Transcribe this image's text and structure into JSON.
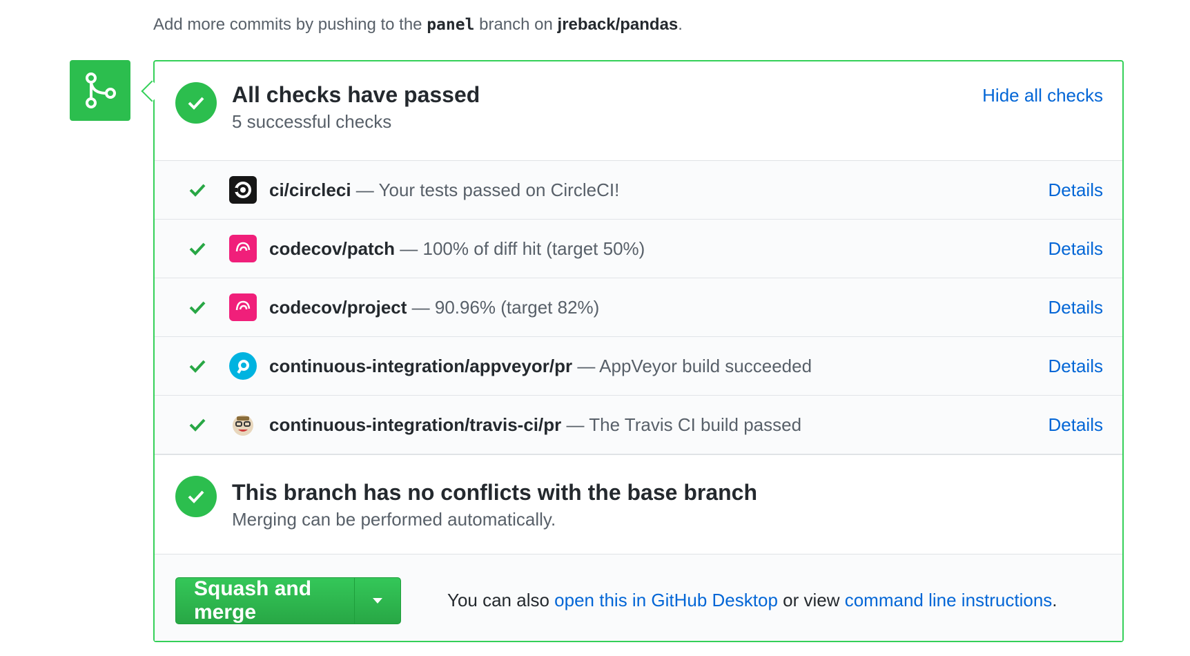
{
  "top_note": {
    "prefix": "Add more commits by pushing to the ",
    "branch": "panel",
    "middle": " branch on ",
    "repo": "jreback/pandas",
    "suffix": "."
  },
  "merge_badge": {
    "icon": "git-merge-icon",
    "color": "#2cbe4e"
  },
  "checks_header": {
    "title": "All checks have passed",
    "subtitle": "5 successful checks",
    "toggle_link": "Hide all checks",
    "status_color": "#2cbe4e"
  },
  "checks": [
    {
      "context": "ci/circleci",
      "separator": " — ",
      "description": "Your tests passed on CircleCI!",
      "details": "Details",
      "icon": "circleci-icon",
      "icon_color": "#161616"
    },
    {
      "context": "codecov/patch",
      "separator": " — ",
      "description": "100% of diff hit (target 50%)",
      "details": "Details",
      "icon": "codecov-icon",
      "icon_color": "#f01f7a"
    },
    {
      "context": "codecov/project",
      "separator": " — ",
      "description": "90.96% (target 82%)",
      "details": "Details",
      "icon": "codecov-icon",
      "icon_color": "#f01f7a"
    },
    {
      "context": "continuous-integration/appveyor/pr",
      "separator": " — ",
      "description": "AppVeyor build succeeded",
      "details": "Details",
      "icon": "appveyor-icon",
      "icon_color": "#00b3e0"
    },
    {
      "context": "continuous-integration/travis-ci/pr",
      "separator": " — ",
      "description": "The Travis CI build passed",
      "details": "Details",
      "icon": "travis-ci-icon",
      "icon_color": "#cd3b3b"
    }
  ],
  "conflicts": {
    "title": "This branch has no conflicts with the base branch",
    "subtitle": "Merging can be performed automatically."
  },
  "merge": {
    "button_label": "Squash and merge",
    "note_prefix": "You can also ",
    "desktop_link": "open this in GitHub Desktop",
    "note_middle": " or view ",
    "cli_link": "command line instructions",
    "note_suffix": "."
  },
  "colors": {
    "success": "#2cbe4e",
    "link": "#0366d6",
    "border": "#34d058"
  }
}
